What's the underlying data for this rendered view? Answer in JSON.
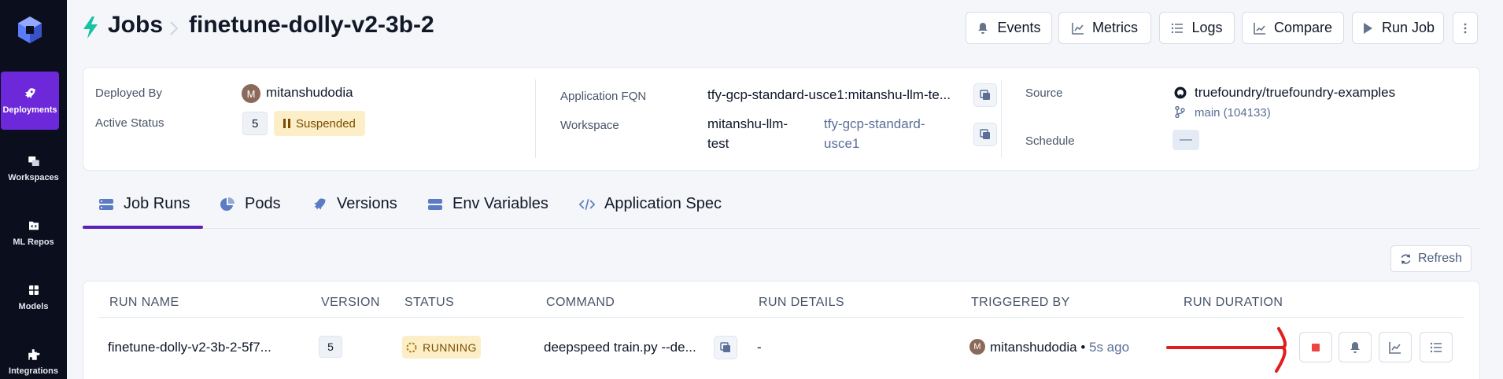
{
  "colors": {
    "sidebar_bg": "#0b0f1d",
    "active_nav": "#6d28d9",
    "bolt": "#17c3a4",
    "suspended_bg": "#fcefc7",
    "stop_red": "#ef4444",
    "annotation_red": "#e11d1d",
    "link": "#5b6f97"
  },
  "sidebar": {
    "items": [
      {
        "label": "Deployments",
        "icon": "rocket-icon",
        "active": true
      },
      {
        "label": "Workspaces",
        "icon": "workspaces-icon"
      },
      {
        "label": "ML Repos",
        "icon": "ml-repos-icon"
      },
      {
        "label": "Models",
        "icon": "models-icon"
      },
      {
        "label": "Integrations",
        "icon": "puzzle-icon"
      }
    ]
  },
  "header": {
    "section": "Jobs",
    "job_name": "finetune-dolly-v2-3b-2",
    "buttons": {
      "events": "Events",
      "metrics": "Metrics",
      "logs": "Logs",
      "compare": "Compare",
      "run_job": "Run Job"
    }
  },
  "details": {
    "deployed_by_label": "Deployed By",
    "deployed_by_initial": "M",
    "deployed_by": "mitanshudodia",
    "active_status_label": "Active Status",
    "active_status_count": "5",
    "status": "Suspended",
    "fqn_label": "Application FQN",
    "fqn": "tfy-gcp-standard-usce1:mitanshu-llm-te...",
    "workspace_label": "Workspace",
    "workspace_line1": "mitanshu-llm-",
    "workspace_line2": "test",
    "workspace_cluster_line1": "tfy-gcp-standard-",
    "workspace_cluster_line2": "usce1",
    "source_label": "Source",
    "source_repo": "truefoundry/truefoundry-examples",
    "source_branch": "main (104133)",
    "schedule_label": "Schedule",
    "schedule": "—"
  },
  "tabs": [
    {
      "label": "Job Runs",
      "icon": "job-runs-icon",
      "active": true
    },
    {
      "label": "Pods",
      "icon": "pie-icon"
    },
    {
      "label": "Versions",
      "icon": "rocket-icon"
    },
    {
      "label": "Env Variables",
      "icon": "env-icon"
    },
    {
      "label": "Application Spec",
      "icon": "code-icon"
    }
  ],
  "refresh_label": "Refresh",
  "table": {
    "headers": [
      "RUN NAME",
      "VERSION",
      "STATUS",
      "COMMAND",
      "RUN DETAILS",
      "TRIGGERED BY",
      "RUN DURATION"
    ],
    "rows": [
      {
        "run_name": "finetune-dolly-v2-3b-2-5f7...",
        "version": "5",
        "status": "RUNNING",
        "command": "deepspeed train.py --de...",
        "run_details": "-",
        "triggered_initial": "M",
        "triggered_by": "mitanshudodia",
        "separator": "•",
        "triggered_ago": "5s ago",
        "run_duration": "-"
      }
    ]
  }
}
